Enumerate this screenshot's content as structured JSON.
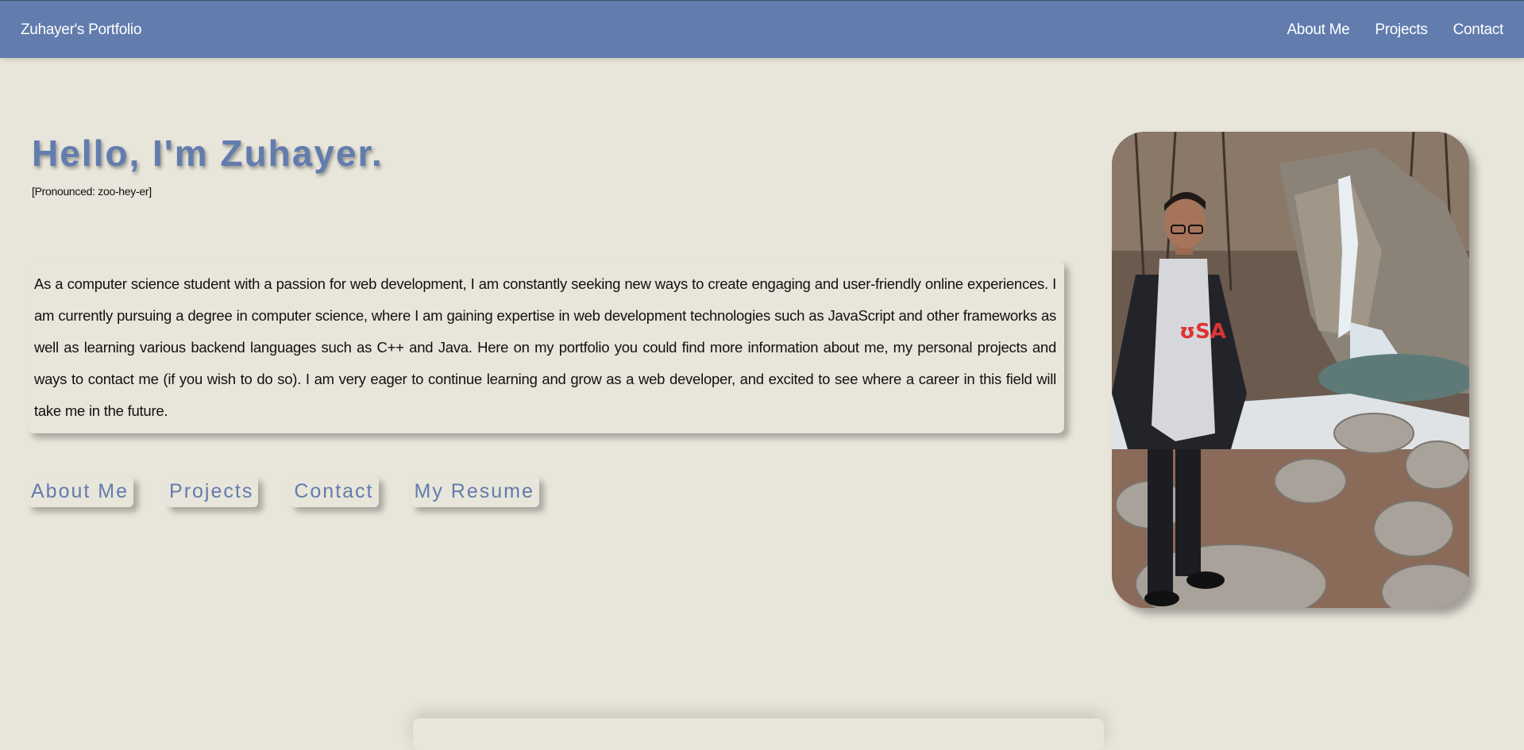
{
  "nav": {
    "brand": "Zuhayer's Portfolio",
    "links": [
      "About Me",
      "Projects",
      "Contact"
    ]
  },
  "hero": {
    "title": "Hello, I'm Zuhayer.",
    "pronunciation": "[Pronounced: zoo-hey-er]",
    "intro": "As a computer science student with a passion for web development, I am constantly seeking new ways to create engaging and user-friendly online experiences. I am currently pursuing a degree in computer science, where I am gaining expertise in web development technologies such as JavaScript and other frameworks as well as learning various backend languages such as C++ and Java. Here on my portfolio you could find more information about me, my personal projects and ways to contact me (if you wish to do so). I am very eager to continue learning and grow as a web developer, and excited to see where a career in this field will take me in the future.",
    "buttons": [
      "About Me",
      "Projects",
      "Contact",
      "My Resume"
    ]
  },
  "colors": {
    "accent": "#627cae",
    "background": "#e8e5da",
    "nav_text": "#ffffff"
  }
}
